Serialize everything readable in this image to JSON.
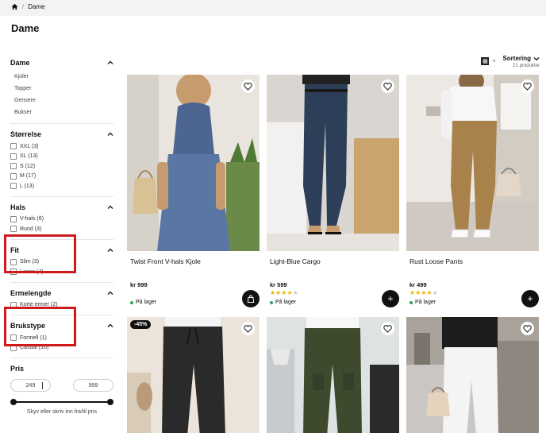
{
  "breadcrumb": {
    "current": "Dame"
  },
  "page": {
    "title": "Dame"
  },
  "sidebar": {
    "category": {
      "title": "Dame",
      "items": [
        "Kjoler",
        "Topper",
        "Gensere",
        "Bukser"
      ]
    },
    "size": {
      "title": "Størrelse",
      "options": [
        "XXL (3)",
        "XL (13)",
        "S (12)",
        "M (17)",
        "L (13)"
      ]
    },
    "neck": {
      "title": "Hals",
      "options": [
        "V-hals (6)",
        "Rund (3)"
      ]
    },
    "fit": {
      "title": "Fit",
      "options": [
        "Slim (3)",
        "Loose (4)"
      ]
    },
    "sleeve": {
      "title": "Ermelengde",
      "options": [
        "Korte ermer (2)"
      ]
    },
    "usage": {
      "title": "Brukstype",
      "options": [
        "Formell (1)",
        "Casual (10)"
      ]
    },
    "price": {
      "title": "Pris",
      "min": "249",
      "max": "999",
      "hint": "Skyv eller skriv inn fra/til pris"
    }
  },
  "sort": {
    "label": "Sortering",
    "count": "21 produkter"
  },
  "products": [
    {
      "name": "Twist Front V-hals Kjole",
      "price": "kr 999",
      "rating": 0,
      "stock": "På lager",
      "button": "bag-icon"
    },
    {
      "name": "Light-Blue Cargo",
      "price": "kr 599",
      "rating": 4,
      "stock": "På lager",
      "button": "plus-icon"
    },
    {
      "name": "Rust Loose Pants",
      "price": "kr 499",
      "rating": 4,
      "stock": "På lager",
      "button": "plus-icon"
    },
    {
      "badge": "-45%"
    },
    {},
    {}
  ],
  "colors": {
    "highlight": "#d0191b",
    "in_stock": "#2fa35a",
    "star": "#f0b400"
  }
}
